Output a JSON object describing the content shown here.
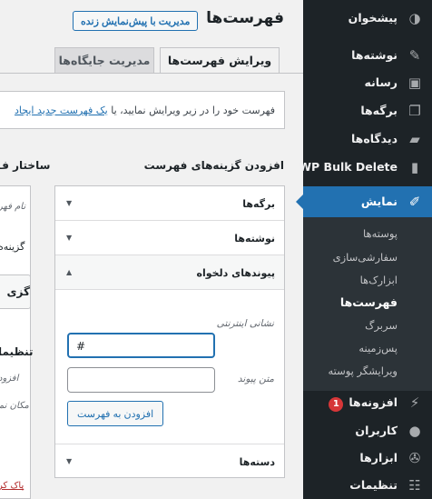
{
  "sidebar": {
    "items": [
      {
        "label": "پیشخوان",
        "icon": "dashboard-icon",
        "glyph": "◑"
      },
      {
        "label": "نوشته‌ها",
        "icon": "pin-icon",
        "glyph": "✎"
      },
      {
        "label": "رسانه",
        "icon": "media-icon",
        "glyph": "▣"
      },
      {
        "label": "برگه‌ها",
        "icon": "pages-icon",
        "glyph": "❐"
      },
      {
        "label": "دیدگاه‌ها",
        "icon": "comments-icon",
        "glyph": "▰"
      },
      {
        "label": "WP Bulk Delete",
        "icon": "trash-icon",
        "glyph": "▮"
      },
      {
        "label": "نمایش",
        "icon": "appearance-brush-icon",
        "glyph": "✐"
      },
      {
        "label": "افزونه‌ها",
        "icon": "plugins-icon",
        "glyph": "⚡",
        "badge": "1"
      },
      {
        "label": "کاربران",
        "icon": "users-icon",
        "glyph": "●"
      },
      {
        "label": "ابزارها",
        "icon": "tools-wrench-icon",
        "glyph": "✇"
      },
      {
        "label": "تنظیمات",
        "icon": "settings-icon",
        "glyph": "☷"
      }
    ],
    "submenu": [
      {
        "label": "پوسته‌ها"
      },
      {
        "label": "سفارشی‌سازی"
      },
      {
        "label": "ابزارک‌ها"
      },
      {
        "label": "فهرست‌ها"
      },
      {
        "label": "سربرگ"
      },
      {
        "label": "پس‌زمینه"
      },
      {
        "label": "ویرایشگر پوسته"
      }
    ]
  },
  "header": {
    "title": "فهرست‌ها",
    "live_button": "مدیریت با پیش‌نمایش زنده"
  },
  "tabs": [
    {
      "label": "ویرایش فهرست‌ها",
      "active": true
    },
    {
      "label": "مدیریت جایگاه‌ها",
      "active": false
    }
  ],
  "notice": {
    "text": "فهرست خود را در زیر ویرایش نمایید، یا",
    "link": "یک فهرست جدید ایجاد"
  },
  "add_items": {
    "heading": "افزودن گزینه‌های فهرست",
    "sections": {
      "pages": "برگه‌ها",
      "posts": "نوشته‌ها",
      "custom_links": "پیوندهای دلخواه",
      "categories": "دسته‌ها"
    },
    "custom_links_form": {
      "url_label": "نشانی اینترنتی",
      "url_value": "#",
      "link_text_label": "متن پیوند",
      "link_text_value": "",
      "add_button": "افزودن به فهرست"
    }
  },
  "menu_structure": {
    "heading": "ساختار ف",
    "name_partial": "نام فهر",
    "select_partial": "گزینه‌ه",
    "button_partial": "گزی",
    "settings_partial": "تنظیما",
    "auto_add_partial": "افزود",
    "location_partial": "مکان نم",
    "delete_partial": "پاک کر"
  },
  "colors": {
    "sidebar_bg": "#1d2327",
    "accent": "#2271b1",
    "badge": "#d63638",
    "delete_link": "#b32d2e"
  }
}
